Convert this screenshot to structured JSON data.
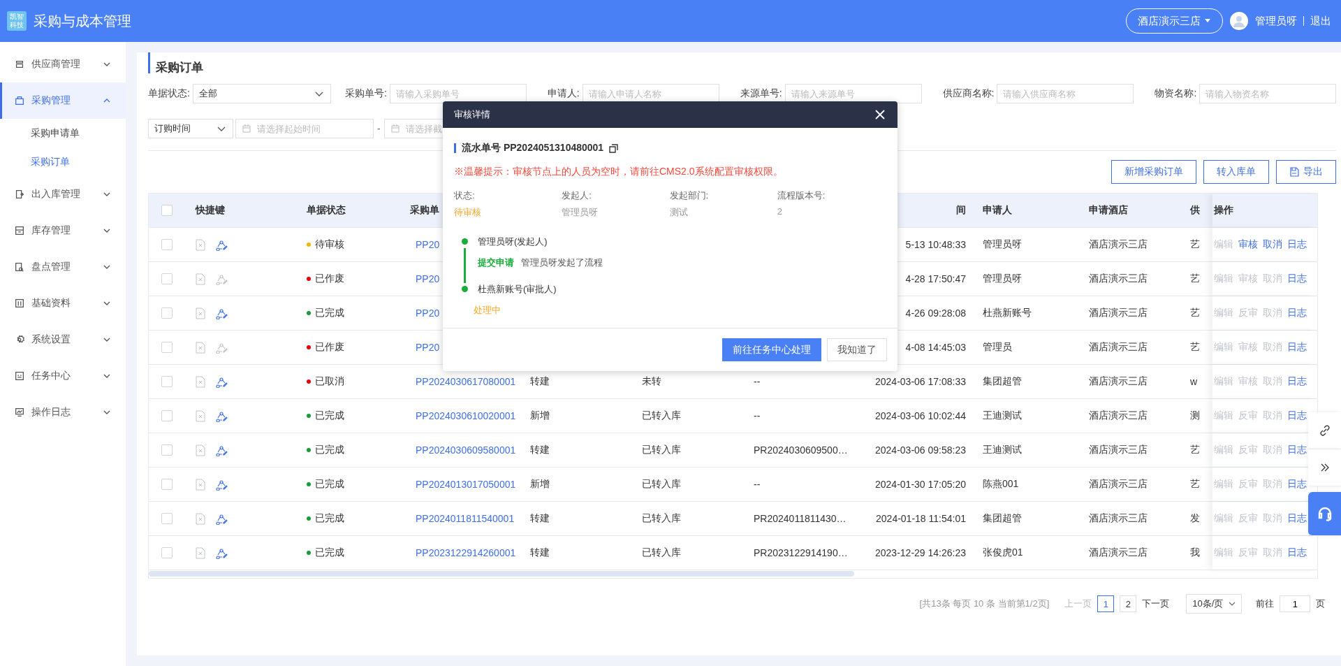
{
  "app": {
    "logo_lines": [
      "凯智",
      "科技"
    ],
    "title": "采购与成本管理",
    "store": "酒店演示三店",
    "user": "管理员呀",
    "logout": "退出"
  },
  "sidebar": {
    "items": [
      {
        "label": "供应商管理",
        "expanded": false,
        "selected": false
      },
      {
        "label": "采购管理",
        "expanded": true,
        "selected": true,
        "children": [
          {
            "label": "采购申请单",
            "selected": false
          },
          {
            "label": "采购订单",
            "selected": true
          }
        ]
      },
      {
        "label": "出入库管理",
        "expanded": false,
        "selected": false
      },
      {
        "label": "库存管理",
        "expanded": false,
        "selected": false
      },
      {
        "label": "盘点管理",
        "expanded": false,
        "selected": false
      },
      {
        "label": "基础资料",
        "expanded": false,
        "selected": false
      },
      {
        "label": "系统设置",
        "expanded": false,
        "selected": false
      },
      {
        "label": "任务中心",
        "expanded": false,
        "selected": false
      },
      {
        "label": "操作日志",
        "expanded": false,
        "selected": false
      }
    ]
  },
  "page_title": "采购订单",
  "filters": [
    {
      "kind": "select",
      "label": "单据状态:",
      "value": "全部"
    },
    {
      "kind": "input",
      "label": "采购单号:",
      "placeholder": "请输入采购单号"
    },
    {
      "kind": "input",
      "label": "申请人:",
      "placeholder": "请输入申请人名称"
    },
    {
      "kind": "input",
      "label": "来源单号:",
      "placeholder": "请输入来源单号"
    },
    {
      "kind": "input",
      "label": "供应商名称:",
      "placeholder": "请输入供应商名称"
    },
    {
      "kind": "input",
      "label": "物资名称:",
      "placeholder": "请输入物资名称"
    }
  ],
  "date_filter": {
    "type": "订购时间",
    "start_placeholder": "请选择起始时间",
    "separator": "-",
    "end_placeholder": "请选择截"
  },
  "toolbar": [
    {
      "label": "新增采购订单",
      "kind": "plain"
    },
    {
      "label": "转入库单",
      "kind": "plain"
    },
    {
      "label": "导出",
      "kind": "export"
    }
  ],
  "table": {
    "all_checked": false,
    "header": {
      "quick": "快捷键",
      "status": "单据状态",
      "order_no": "采购单",
      "time": "间",
      "applicant": "申请人",
      "hotel": "申请酒店",
      "supplier": "供",
      "actions": "操作"
    },
    "rows": [
      {
        "checked": false,
        "share_enabled": true,
        "status": "待审核",
        "color": "#f5b400",
        "order_no": "PP20",
        "time": "5-13 10:48:33",
        "applicant": "管理员呀",
        "hotel": "酒店演示三店",
        "supplier": "艺",
        "actions": [
          {
            "label": "编辑",
            "disabled": true
          },
          {
            "label": "审核",
            "disabled": false
          },
          {
            "label": "取消",
            "disabled": false
          },
          {
            "label": "日志",
            "disabled": false
          }
        ]
      },
      {
        "checked": false,
        "share_enabled": false,
        "status": "已作废",
        "color": "#e8000b",
        "order_no": "PP20",
        "time": "4-28 17:50:47",
        "applicant": "管理员呀",
        "hotel": "酒店演示三店",
        "supplier": "艺",
        "actions": [
          {
            "label": "编辑",
            "disabled": true
          },
          {
            "label": "审核",
            "disabled": true
          },
          {
            "label": "取消",
            "disabled": true
          },
          {
            "label": "日志",
            "disabled": false
          }
        ]
      },
      {
        "checked": false,
        "share_enabled": true,
        "status": "已完成",
        "color": "#1a9b3b",
        "order_no": "PP20",
        "time": "4-26 09:28:08",
        "applicant": "杜燕新账号",
        "hotel": "酒店演示三店",
        "supplier": "艺",
        "actions": [
          {
            "label": "编辑",
            "disabled": true
          },
          {
            "label": "反审",
            "disabled": true
          },
          {
            "label": "取消",
            "disabled": true
          },
          {
            "label": "日志",
            "disabled": false
          }
        ]
      },
      {
        "checked": false,
        "share_enabled": false,
        "status": "已作废",
        "color": "#e8000b",
        "order_no": "PP20",
        "time": "4-08 14:45:03",
        "applicant": "管理员",
        "hotel": "酒店演示三店",
        "supplier": "艺",
        "actions": [
          {
            "label": "编辑",
            "disabled": true
          },
          {
            "label": "审核",
            "disabled": true
          },
          {
            "label": "取消",
            "disabled": true
          },
          {
            "label": "日志",
            "disabled": false
          }
        ]
      },
      {
        "checked": false,
        "share_enabled": true,
        "status": "已取消",
        "color": "#e8000b",
        "order_no": "PP2024030617080001",
        "type": "转建",
        "transfer": "未转",
        "source": "--",
        "time": "2024-03-06 17:08:33",
        "applicant": "集团超管",
        "hotel": "酒店演示三店",
        "supplier": "w",
        "actions": [
          {
            "label": "编辑",
            "disabled": true
          },
          {
            "label": "审核",
            "disabled": true
          },
          {
            "label": "取消",
            "disabled": true
          },
          {
            "label": "日志",
            "disabled": false
          }
        ]
      },
      {
        "checked": false,
        "share_enabled": true,
        "status": "已完成",
        "color": "#1a9b3b",
        "order_no": "PP2024030610020001",
        "type": "新增",
        "transfer": "已转入库",
        "source": "--",
        "time": "2024-03-06 10:02:44",
        "applicant": "王迪测试",
        "hotel": "酒店演示三店",
        "supplier": "测",
        "actions": [
          {
            "label": "编辑",
            "disabled": true
          },
          {
            "label": "反审",
            "disabled": true
          },
          {
            "label": "取消",
            "disabled": true
          },
          {
            "label": "日志",
            "disabled": false
          }
        ]
      },
      {
        "checked": false,
        "share_enabled": true,
        "status": "已完成",
        "color": "#1a9b3b",
        "order_no": "PP2024030609580001",
        "type": "转建",
        "transfer": "已转入库",
        "source": "PR2024030609500…",
        "time": "2024-03-06 09:58:23",
        "applicant": "王迪测试",
        "hotel": "酒店演示三店",
        "supplier": "艺",
        "actions": [
          {
            "label": "编辑",
            "disabled": true
          },
          {
            "label": "反审",
            "disabled": true
          },
          {
            "label": "取消",
            "disabled": true
          },
          {
            "label": "日志",
            "disabled": false
          }
        ]
      },
      {
        "checked": false,
        "share_enabled": true,
        "status": "已完成",
        "color": "#1a9b3b",
        "order_no": "PP2024013017050001",
        "type": "新增",
        "transfer": "已转入库",
        "source": "--",
        "time": "2024-01-30 17:05:20",
        "applicant": "陈燕001",
        "hotel": "酒店演示三店",
        "supplier": "艺",
        "actions": [
          {
            "label": "编辑",
            "disabled": true
          },
          {
            "label": "反审",
            "disabled": true
          },
          {
            "label": "取消",
            "disabled": true
          },
          {
            "label": "日志",
            "disabled": false
          }
        ]
      },
      {
        "checked": false,
        "share_enabled": true,
        "status": "已完成",
        "color": "#1a9b3b",
        "order_no": "PP2024011811540001",
        "type": "转建",
        "transfer": "已转入库",
        "source": "PR2024011811430…",
        "time": "2024-01-18 11:54:01",
        "applicant": "集团超管",
        "hotel": "酒店演示三店",
        "supplier": "发",
        "actions": [
          {
            "label": "编辑",
            "disabled": true
          },
          {
            "label": "反审",
            "disabled": true
          },
          {
            "label": "取消",
            "disabled": true
          },
          {
            "label": "日志",
            "disabled": false
          }
        ]
      },
      {
        "checked": false,
        "share_enabled": true,
        "status": "已完成",
        "color": "#1a9b3b",
        "order_no": "PP2023122914260001",
        "type": "转建",
        "transfer": "已转入库",
        "source": "PR2023122914190…",
        "time": "2023-12-29 14:26:23",
        "applicant": "张俊虎01",
        "hotel": "酒店演示三店",
        "supplier": "我",
        "actions": [
          {
            "label": "编辑",
            "disabled": true
          },
          {
            "label": "反审",
            "disabled": true
          },
          {
            "label": "取消",
            "disabled": true
          },
          {
            "label": "日志",
            "disabled": false
          }
        ]
      }
    ]
  },
  "pagination": {
    "summary": "[共13条 每页 10 条 当前第1/2页]",
    "prev": "上一页",
    "prev_disabled": true,
    "pages": [
      {
        "label": "1",
        "selected": true
      },
      {
        "label": "2",
        "selected": false
      }
    ],
    "next": "下一页",
    "page_size": "10条/页",
    "goto_label": "前往",
    "goto_value": "1",
    "goto_unit": "页"
  },
  "dialog": {
    "title": "审核详情",
    "serial_label": "流水单号 PP2024051310480001",
    "notice": "※温馨提示：审核节点上的人员为空时，请前往CMS2.0系统配置审核权限。",
    "info": [
      {
        "label": "状态:",
        "value": "待审核",
        "kind": "status"
      },
      {
        "label": "发起人:",
        "value": "管理员呀",
        "kind": "plain"
      },
      {
        "label": "发起部门:",
        "value": "测试",
        "kind": "plain"
      },
      {
        "label": "流程版本号:",
        "value": "2",
        "kind": "plain"
      }
    ],
    "timeline": [
      {
        "name": "管理员呀(发起人)",
        "kind": "done",
        "action": "提交申请",
        "detail": "管理员呀发起了流程"
      },
      {
        "name": "杜燕新账号(审批人)",
        "kind": "pending",
        "action": "处理中"
      }
    ],
    "buttons": [
      {
        "label": "前往任务中心处理",
        "kind": "primary"
      },
      {
        "label": "我知道了",
        "kind": "default"
      }
    ]
  }
}
